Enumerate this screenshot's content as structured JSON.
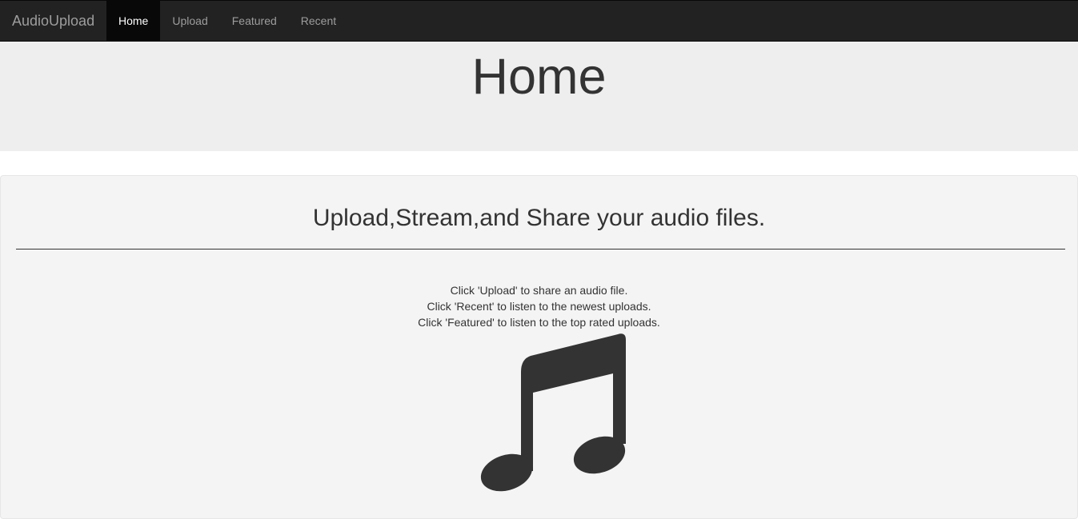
{
  "navbar": {
    "brand": "AudioUpload",
    "items": [
      {
        "label": "Home",
        "active": true
      },
      {
        "label": "Upload",
        "active": false
      },
      {
        "label": "Featured",
        "active": false
      },
      {
        "label": "Recent",
        "active": false
      }
    ]
  },
  "jumbotron": {
    "title": "Home"
  },
  "main": {
    "tagline": "Upload,Stream,and Share your audio files.",
    "instructions": [
      "Click 'Upload' to share an audio file.",
      "Click 'Recent' to listen to the newest uploads.",
      "Click 'Featured' to listen to the top rated uploads."
    ],
    "icon": "music-note-icon"
  },
  "colors": {
    "navbar_bg": "#222222",
    "nav_active_bg": "#080808",
    "jumbotron_bg": "#eeeeee",
    "well_bg": "#f4f4f4",
    "text": "#333333"
  }
}
